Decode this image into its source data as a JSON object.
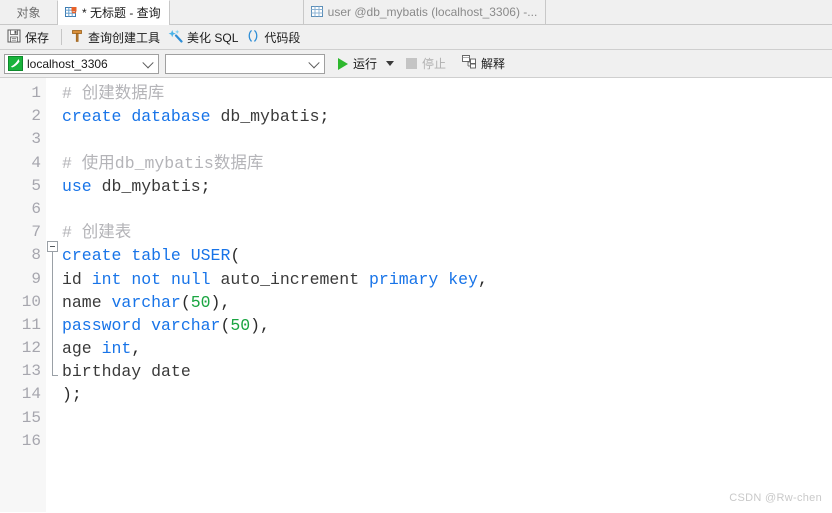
{
  "tabbar": {
    "objects_tab": "对象",
    "tabs": [
      {
        "label": "* 无标题 - 查询",
        "icon": "grid-icon",
        "active": true
      },
      {
        "label": "user @db_mybatis (localhost_3306) -...",
        "icon": "grid-icon",
        "active": false
      }
    ]
  },
  "toolbar": {
    "save_label": "保存",
    "save_icon": "save-disk-icon",
    "query_builder_label": "查询创建工具",
    "query_builder_icon": "builder-tool-icon",
    "beautify_label": "美化 SQL",
    "beautify_icon": "sparkle-wand-icon",
    "snippet_label": "代码段",
    "snippet_icon": "parentheses-icon"
  },
  "connbar": {
    "connection_value": "localhost_3306",
    "connection_icon": "connection-icon",
    "database_value": "",
    "database_placeholder": "",
    "run_label": "运行",
    "run_icon": "play-triangle-icon",
    "run_dropdown_icon": "caret-down-icon",
    "stop_label": "停止",
    "stop_icon": "stop-square-icon",
    "stop_enabled": false,
    "explain_label": "解释",
    "explain_icon": "explain-plan-icon"
  },
  "editor": {
    "line_numbers": [
      "1",
      "2",
      "3",
      "4",
      "5",
      "6",
      "7",
      "8",
      "9",
      "10",
      "11",
      "12",
      "13",
      "14",
      "15",
      "16"
    ],
    "fold_marker_line": 8,
    "fold_end_line": 14,
    "lines": [
      {
        "num": "1",
        "tokens": [
          {
            "t": "# 创建数据库",
            "c": "c"
          }
        ]
      },
      {
        "num": "2",
        "tokens": [
          {
            "t": "create",
            "c": "k"
          },
          {
            "t": " ",
            "c": "p"
          },
          {
            "t": "database",
            "c": "k"
          },
          {
            "t": " ",
            "c": "p"
          },
          {
            "t": "db_mybatis",
            "c": "t"
          },
          {
            "t": ";",
            "c": "p"
          }
        ]
      },
      {
        "num": "3",
        "tokens": []
      },
      {
        "num": "4",
        "tokens": [
          {
            "t": "# 使用db_mybatis数据库",
            "c": "c"
          }
        ]
      },
      {
        "num": "5",
        "tokens": [
          {
            "t": "use",
            "c": "k"
          },
          {
            "t": " ",
            "c": "p"
          },
          {
            "t": "db_mybatis",
            "c": "t"
          },
          {
            "t": ";",
            "c": "p"
          }
        ]
      },
      {
        "num": "6",
        "tokens": []
      },
      {
        "num": "7",
        "tokens": [
          {
            "t": "# 创建表",
            "c": "c"
          }
        ]
      },
      {
        "num": "8",
        "tokens": [
          {
            "t": "create",
            "c": "k"
          },
          {
            "t": " ",
            "c": "p"
          },
          {
            "t": "table",
            "c": "k"
          },
          {
            "t": " ",
            "c": "p"
          },
          {
            "t": "USER",
            "c": "k"
          },
          {
            "t": "(",
            "c": "p"
          }
        ]
      },
      {
        "num": "9",
        "tokens": [
          {
            "t": "id ",
            "c": "t"
          },
          {
            "t": "int",
            "c": "k"
          },
          {
            "t": " ",
            "c": "p"
          },
          {
            "t": "not",
            "c": "k"
          },
          {
            "t": " ",
            "c": "p"
          },
          {
            "t": "null",
            "c": "k"
          },
          {
            "t": " auto_increment ",
            "c": "t"
          },
          {
            "t": "primary",
            "c": "k"
          },
          {
            "t": " ",
            "c": "p"
          },
          {
            "t": "key",
            "c": "k"
          },
          {
            "t": ",",
            "c": "p"
          }
        ]
      },
      {
        "num": "10",
        "tokens": [
          {
            "t": "name",
            "c": "t"
          },
          {
            "t": " ",
            "c": "p"
          },
          {
            "t": "varchar",
            "c": "k"
          },
          {
            "t": "(",
            "c": "p"
          },
          {
            "t": "50",
            "c": "n"
          },
          {
            "t": "),",
            "c": "p"
          }
        ]
      },
      {
        "num": "11",
        "tokens": [
          {
            "t": "password",
            "c": "k"
          },
          {
            "t": " ",
            "c": "p"
          },
          {
            "t": "varchar",
            "c": "k"
          },
          {
            "t": "(",
            "c": "p"
          },
          {
            "t": "50",
            "c": "n"
          },
          {
            "t": "),",
            "c": "p"
          }
        ]
      },
      {
        "num": "12",
        "tokens": [
          {
            "t": "age ",
            "c": "t"
          },
          {
            "t": "int",
            "c": "k"
          },
          {
            "t": ",",
            "c": "p"
          }
        ]
      },
      {
        "num": "13",
        "tokens": [
          {
            "t": "birthday ",
            "c": "t"
          },
          {
            "t": "date",
            "c": "t"
          }
        ]
      },
      {
        "num": "14",
        "tokens": [
          {
            "t": ");",
            "c": "p"
          }
        ]
      },
      {
        "num": "15",
        "tokens": []
      },
      {
        "num": "16",
        "tokens": []
      }
    ]
  },
  "watermark": "CSDN @Rw-chen",
  "colors": {
    "keyword": "#1874e8",
    "number": "#1aa541",
    "comment": "#b4b4b8",
    "plain": "#3a3a3a",
    "chrome": "#f0f0f0",
    "gutter": "#f7f7f7",
    "run_green": "#2eb82e",
    "connection_green": "#19b33c"
  }
}
